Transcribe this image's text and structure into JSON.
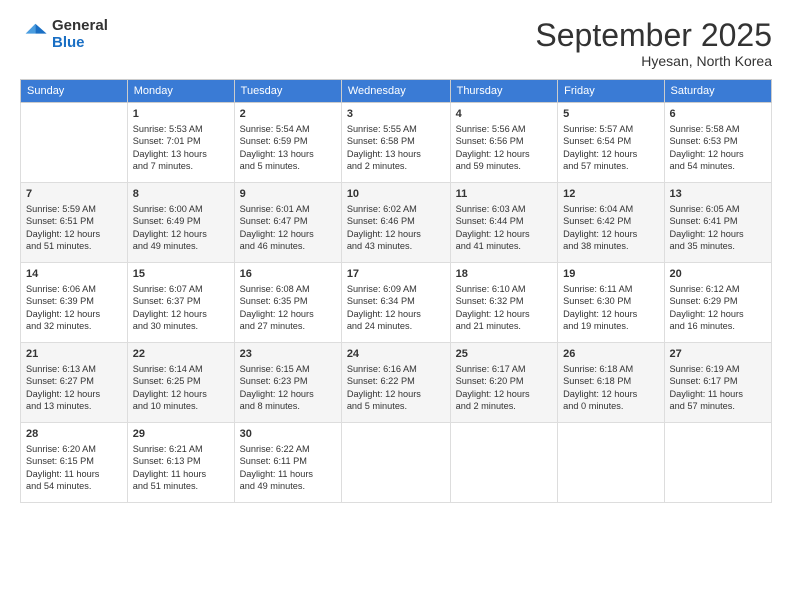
{
  "logo": {
    "general": "General",
    "blue": "Blue"
  },
  "title": "September 2025",
  "subtitle": "Hyesan, North Korea",
  "days_of_week": [
    "Sunday",
    "Monday",
    "Tuesday",
    "Wednesday",
    "Thursday",
    "Friday",
    "Saturday"
  ],
  "weeks": [
    [
      {
        "num": "",
        "info": ""
      },
      {
        "num": "1",
        "info": "Sunrise: 5:53 AM\nSunset: 7:01 PM\nDaylight: 13 hours\nand 7 minutes."
      },
      {
        "num": "2",
        "info": "Sunrise: 5:54 AM\nSunset: 6:59 PM\nDaylight: 13 hours\nand 5 minutes."
      },
      {
        "num": "3",
        "info": "Sunrise: 5:55 AM\nSunset: 6:58 PM\nDaylight: 13 hours\nand 2 minutes."
      },
      {
        "num": "4",
        "info": "Sunrise: 5:56 AM\nSunset: 6:56 PM\nDaylight: 12 hours\nand 59 minutes."
      },
      {
        "num": "5",
        "info": "Sunrise: 5:57 AM\nSunset: 6:54 PM\nDaylight: 12 hours\nand 57 minutes."
      },
      {
        "num": "6",
        "info": "Sunrise: 5:58 AM\nSunset: 6:53 PM\nDaylight: 12 hours\nand 54 minutes."
      }
    ],
    [
      {
        "num": "7",
        "info": "Sunrise: 5:59 AM\nSunset: 6:51 PM\nDaylight: 12 hours\nand 51 minutes."
      },
      {
        "num": "8",
        "info": "Sunrise: 6:00 AM\nSunset: 6:49 PM\nDaylight: 12 hours\nand 49 minutes."
      },
      {
        "num": "9",
        "info": "Sunrise: 6:01 AM\nSunset: 6:47 PM\nDaylight: 12 hours\nand 46 minutes."
      },
      {
        "num": "10",
        "info": "Sunrise: 6:02 AM\nSunset: 6:46 PM\nDaylight: 12 hours\nand 43 minutes."
      },
      {
        "num": "11",
        "info": "Sunrise: 6:03 AM\nSunset: 6:44 PM\nDaylight: 12 hours\nand 41 minutes."
      },
      {
        "num": "12",
        "info": "Sunrise: 6:04 AM\nSunset: 6:42 PM\nDaylight: 12 hours\nand 38 minutes."
      },
      {
        "num": "13",
        "info": "Sunrise: 6:05 AM\nSunset: 6:41 PM\nDaylight: 12 hours\nand 35 minutes."
      }
    ],
    [
      {
        "num": "14",
        "info": "Sunrise: 6:06 AM\nSunset: 6:39 PM\nDaylight: 12 hours\nand 32 minutes."
      },
      {
        "num": "15",
        "info": "Sunrise: 6:07 AM\nSunset: 6:37 PM\nDaylight: 12 hours\nand 30 minutes."
      },
      {
        "num": "16",
        "info": "Sunrise: 6:08 AM\nSunset: 6:35 PM\nDaylight: 12 hours\nand 27 minutes."
      },
      {
        "num": "17",
        "info": "Sunrise: 6:09 AM\nSunset: 6:34 PM\nDaylight: 12 hours\nand 24 minutes."
      },
      {
        "num": "18",
        "info": "Sunrise: 6:10 AM\nSunset: 6:32 PM\nDaylight: 12 hours\nand 21 minutes."
      },
      {
        "num": "19",
        "info": "Sunrise: 6:11 AM\nSunset: 6:30 PM\nDaylight: 12 hours\nand 19 minutes."
      },
      {
        "num": "20",
        "info": "Sunrise: 6:12 AM\nSunset: 6:29 PM\nDaylight: 12 hours\nand 16 minutes."
      }
    ],
    [
      {
        "num": "21",
        "info": "Sunrise: 6:13 AM\nSunset: 6:27 PM\nDaylight: 12 hours\nand 13 minutes."
      },
      {
        "num": "22",
        "info": "Sunrise: 6:14 AM\nSunset: 6:25 PM\nDaylight: 12 hours\nand 10 minutes."
      },
      {
        "num": "23",
        "info": "Sunrise: 6:15 AM\nSunset: 6:23 PM\nDaylight: 12 hours\nand 8 minutes."
      },
      {
        "num": "24",
        "info": "Sunrise: 6:16 AM\nSunset: 6:22 PM\nDaylight: 12 hours\nand 5 minutes."
      },
      {
        "num": "25",
        "info": "Sunrise: 6:17 AM\nSunset: 6:20 PM\nDaylight: 12 hours\nand 2 minutes."
      },
      {
        "num": "26",
        "info": "Sunrise: 6:18 AM\nSunset: 6:18 PM\nDaylight: 12 hours\nand 0 minutes."
      },
      {
        "num": "27",
        "info": "Sunrise: 6:19 AM\nSunset: 6:17 PM\nDaylight: 11 hours\nand 57 minutes."
      }
    ],
    [
      {
        "num": "28",
        "info": "Sunrise: 6:20 AM\nSunset: 6:15 PM\nDaylight: 11 hours\nand 54 minutes."
      },
      {
        "num": "29",
        "info": "Sunrise: 6:21 AM\nSunset: 6:13 PM\nDaylight: 11 hours\nand 51 minutes."
      },
      {
        "num": "30",
        "info": "Sunrise: 6:22 AM\nSunset: 6:11 PM\nDaylight: 11 hours\nand 49 minutes."
      },
      {
        "num": "",
        "info": ""
      },
      {
        "num": "",
        "info": ""
      },
      {
        "num": "",
        "info": ""
      },
      {
        "num": "",
        "info": ""
      }
    ]
  ]
}
